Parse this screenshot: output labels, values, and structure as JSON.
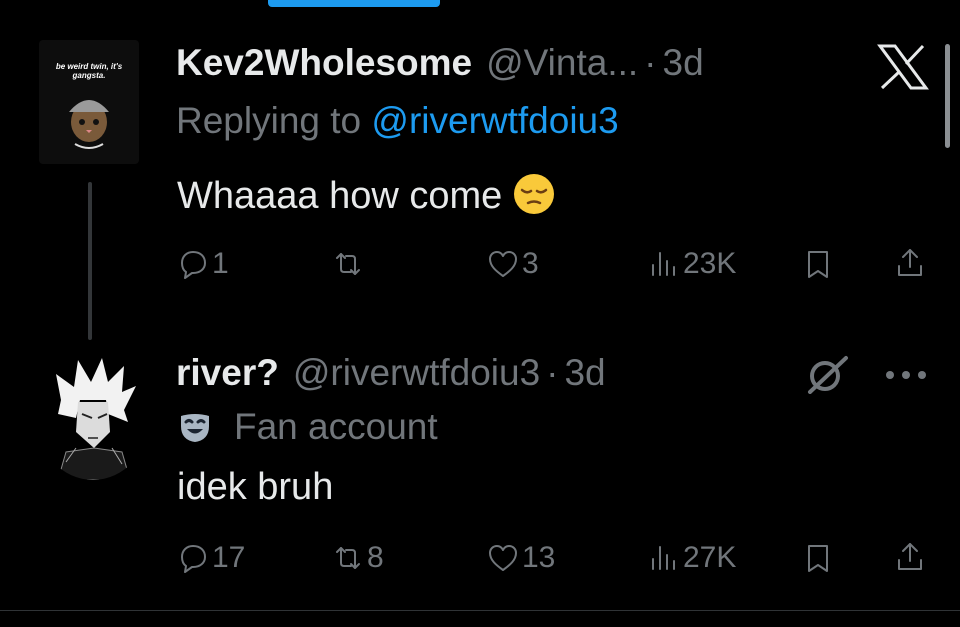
{
  "tweets": [
    {
      "display_name": "Kev2Wholesome",
      "handle": "@Vinta...",
      "separator": "·",
      "time": "3d",
      "replying_prefix": "Replying to",
      "replying_handle": "@riverwtfdoiu3",
      "text": "Whaaaa how come",
      "emoji": "pensive-face",
      "avatar_caption": "be weird twin, it's gangsta.",
      "actions": {
        "replies": "1",
        "reposts": "",
        "likes": "3",
        "views": "23K"
      }
    },
    {
      "display_name": "river?",
      "handle": "@riverwtfdoiu3",
      "separator": "·",
      "time": "3d",
      "label": "Fan account",
      "text": "idek bruh",
      "actions": {
        "replies": "17",
        "reposts": "8",
        "likes": "13",
        "views": "27K"
      }
    }
  ],
  "icons": {
    "brand": "x-logo",
    "tweet2_top_right": [
      "grok-icon",
      "more-icon"
    ]
  },
  "colors": {
    "background": "#000000",
    "text": "#e7e9ea",
    "muted": "#71767b",
    "accent": "#1d9bf0"
  }
}
